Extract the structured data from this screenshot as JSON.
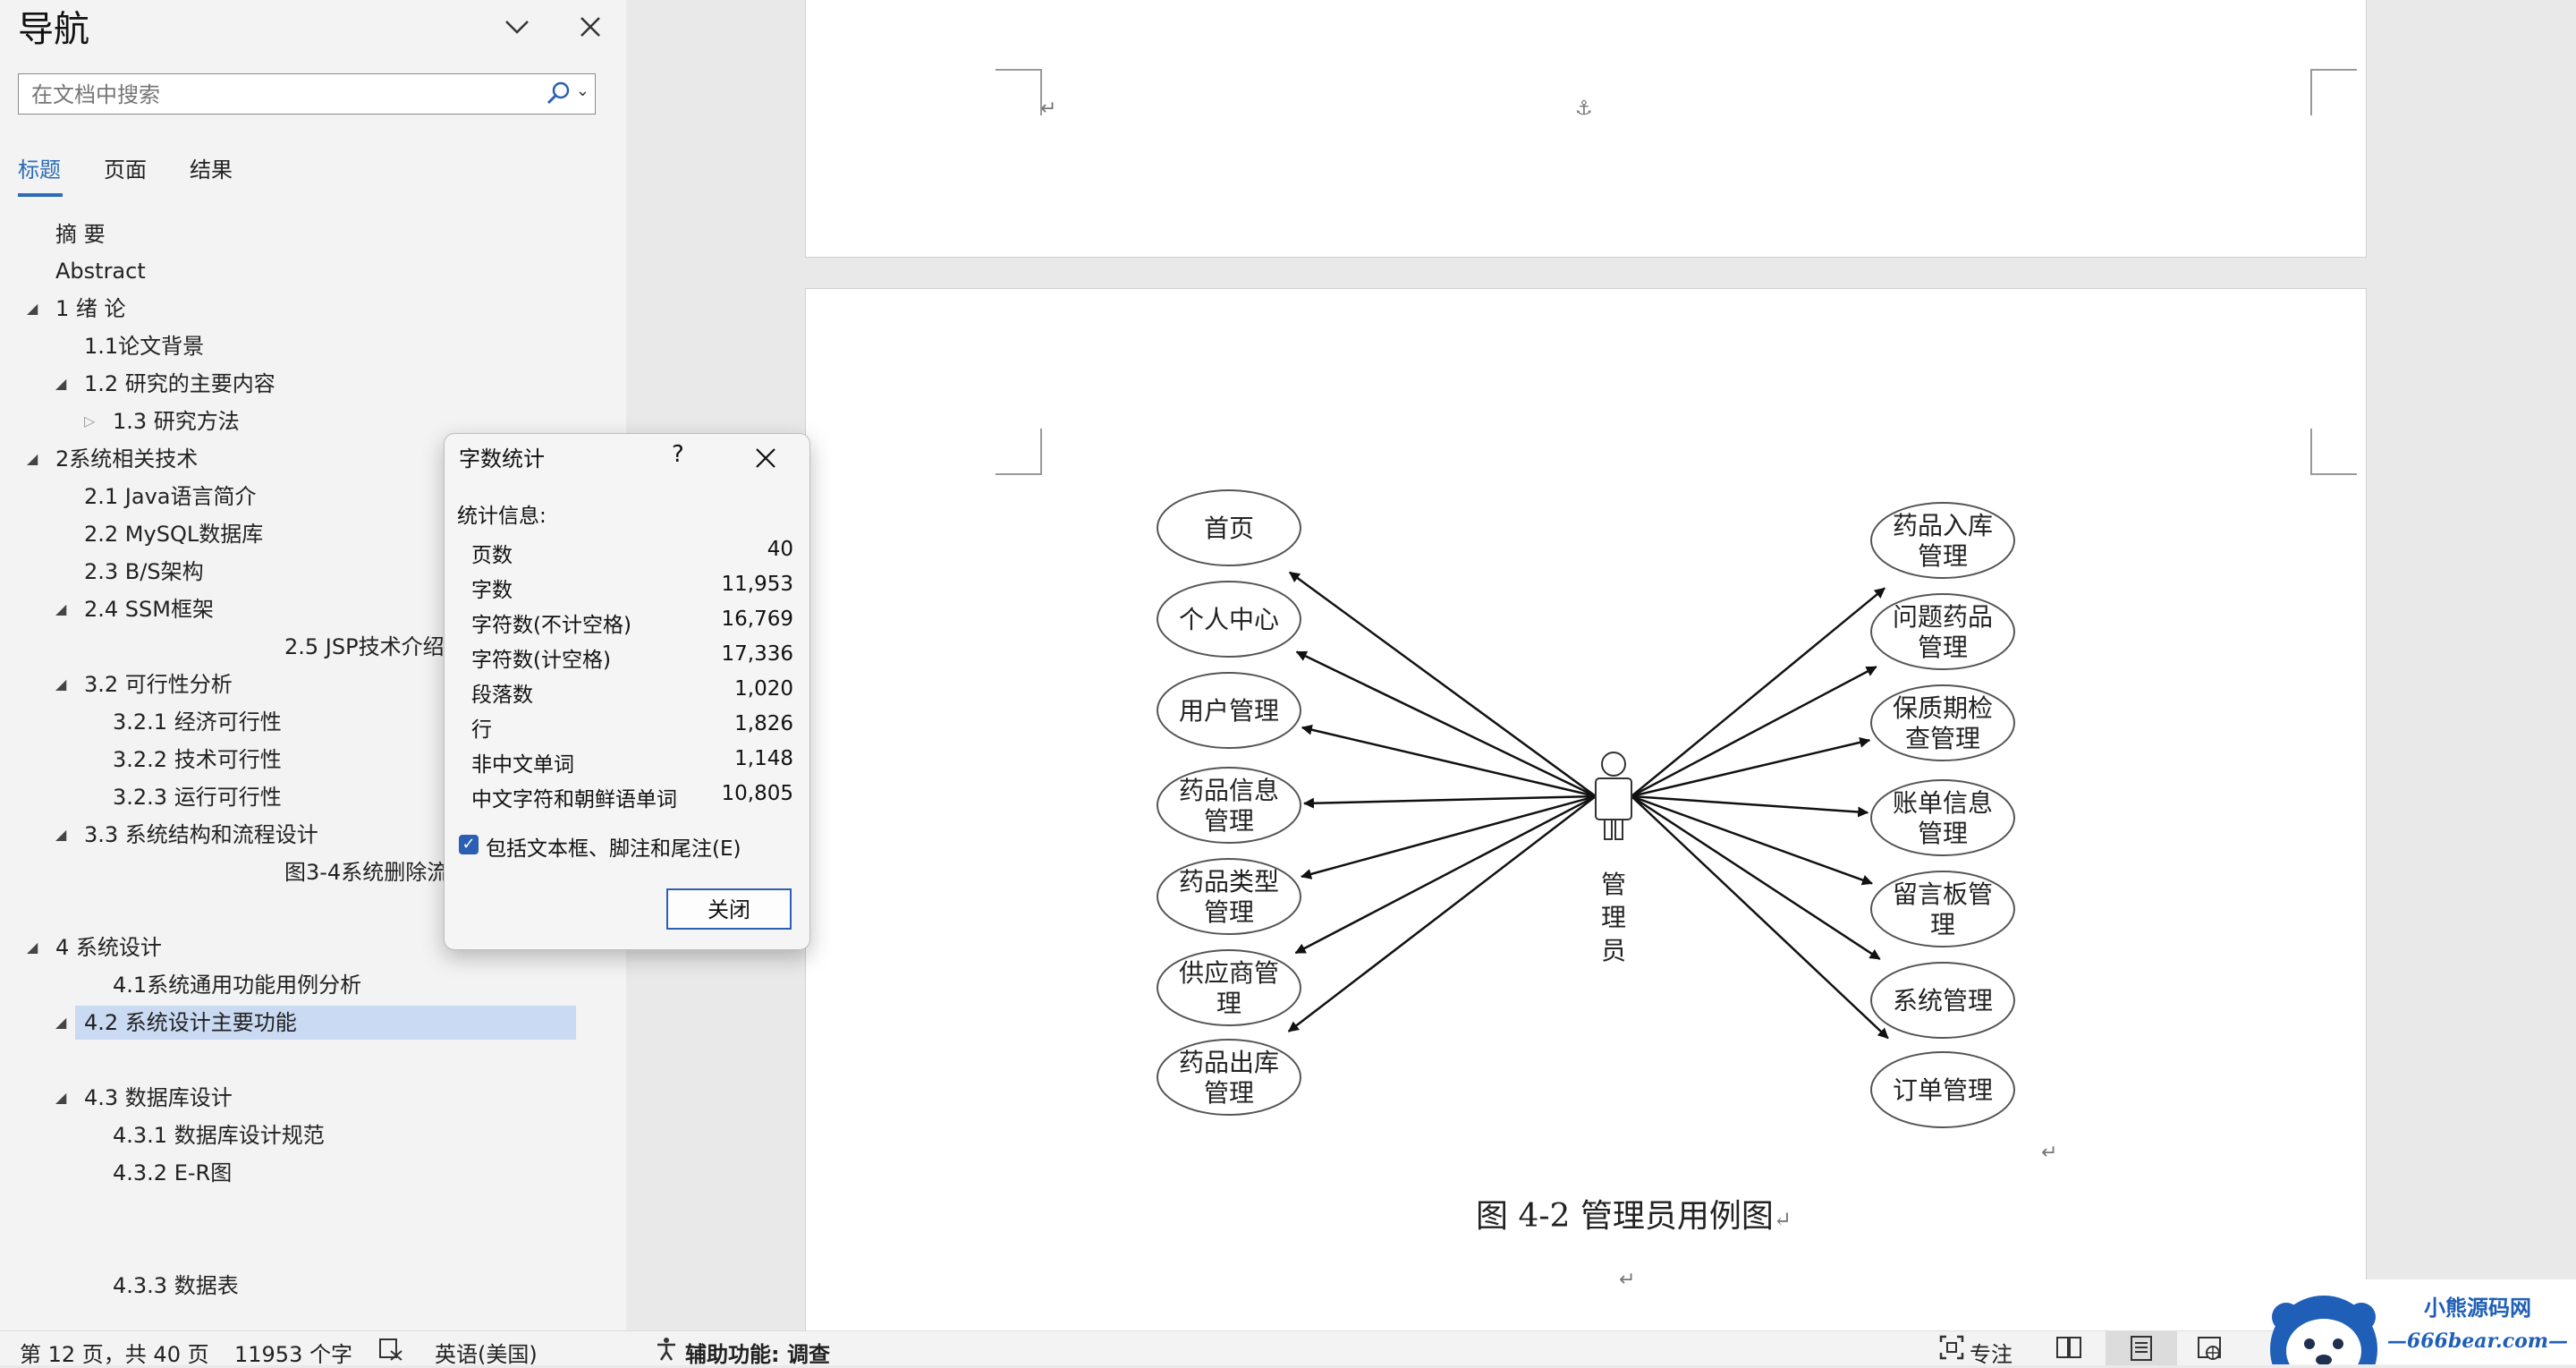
{
  "nav": {
    "title": "导航",
    "search_placeholder": "在文档中搜索",
    "tabs": [
      "标题",
      "页面",
      "结果"
    ],
    "headings": [
      "摘  要",
      "Abstract",
      "1 绪  论",
      "1.1论文背景",
      "1.2 研究的主要内容",
      "1.3 研究方法",
      "2系统相关技术",
      "2.1 Java语言简介",
      "2.2  MySQL数据库",
      "2.3 B/S架构",
      "2.4 SSM框架",
      "2.5 JSP技术介绍",
      "3.2 可行性分析",
      "3.2.1 经济可行性",
      "3.2.2 技术可行性",
      "3.2.3 运行可行性",
      "3.3 系统结构和流程设计",
      "图3-4系统删除流",
      "4 系统设计",
      "4.1系统通用功能用例分析",
      "4.2 系统设计主要功能",
      "4.3 数据库设计",
      "4.3.1 数据库设计规范",
      "4.3.2 E-R图",
      "4.3.3 数据表"
    ]
  },
  "dialog": {
    "title": "字数统计",
    "help": "?",
    "section": "统计信息:",
    "stats": [
      {
        "label": "页数",
        "value": "40"
      },
      {
        "label": "字数",
        "value": "11,953"
      },
      {
        "label": "字符数(不计空格)",
        "value": "16,769"
      },
      {
        "label": "字符数(计空格)",
        "value": "17,336"
      },
      {
        "label": "段落数",
        "value": "1,020"
      },
      {
        "label": "行",
        "value": "1,826"
      },
      {
        "label": "非中文单词",
        "value": "1,148"
      },
      {
        "label": "中文字符和朝鲜语单词",
        "value": "10,805"
      }
    ],
    "checkbox_label": "包括文本框、脚注和尾注(E)",
    "checkbox_checked": true,
    "close_label": "关闭"
  },
  "diagram": {
    "actor": [
      "管",
      "理",
      "员"
    ],
    "left_cases": [
      [
        "首页"
      ],
      [
        "个人中心"
      ],
      [
        "用户管理"
      ],
      [
        "药品信息",
        "管理"
      ],
      [
        "药品类型",
        "管理"
      ],
      [
        "供应商管",
        "理"
      ],
      [
        "药品出库",
        "管理"
      ]
    ],
    "right_cases": [
      [
        "药品入库",
        "管理"
      ],
      [
        "问题药品",
        "管理"
      ],
      [
        "保质期检",
        "查管理"
      ],
      [
        "账单信息",
        "管理"
      ],
      [
        "留言板管",
        "理"
      ],
      [
        "系统管理"
      ],
      [
        "订单管理"
      ]
    ],
    "caption": "图 4-2 管理员用例图"
  },
  "status": {
    "page": "第 12 页，共 40 页",
    "words": "11953 个字",
    "language": "英语(美国)",
    "accessibility": "辅助功能: 调查",
    "focus": "专注"
  },
  "watermark": {
    "line1": "小熊源码网",
    "line2": "—666bear.com—"
  },
  "colors": {
    "accent": "#2b6cb8",
    "selected": "#c9daf2"
  }
}
